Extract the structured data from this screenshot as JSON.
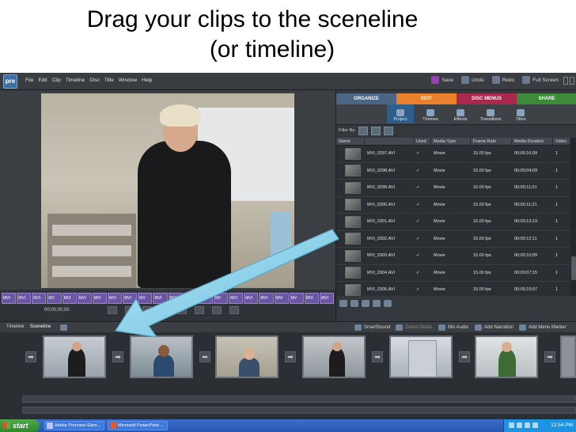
{
  "slide": {
    "title_line1": "Drag your clips to the sceneline",
    "title_line2": "(or timeline)"
  },
  "app": {
    "logo_text": "pre",
    "menu": [
      "File",
      "Edit",
      "Clip",
      "Timeline",
      "Disc",
      "Title",
      "Window",
      "Help"
    ],
    "top_buttons": {
      "save": "Save",
      "undo": "Undo",
      "redo": "Redo",
      "full_screen": "Full Screen"
    }
  },
  "monitor": {
    "timecode": "00;00;00;00",
    "filmstrip": [
      "MVI",
      "MVI",
      "MVI",
      "MV",
      "MVI",
      "MVI",
      "MVI",
      "MVI",
      "MVI",
      "MV",
      "MVI",
      "MVI",
      "MVI",
      "MVI",
      "MV",
      "MVI",
      "MVI",
      "MVI",
      "MVI",
      "MV",
      "MVI",
      "MVI"
    ]
  },
  "panel": {
    "main_tabs": [
      "ORGANIZE",
      "EDIT",
      "DISC MENUS",
      "SHARE"
    ],
    "active_main_tab": "EDIT",
    "sub_tabs": [
      "Project",
      "Themes",
      "Effects",
      "Transitions",
      "Titles"
    ],
    "active_sub_tab": "Project",
    "filter_label": "Filter By:",
    "columns": [
      "Name",
      "",
      "Used",
      "Media Type",
      "Frame Rate",
      "Media Duration",
      "Video"
    ],
    "rows": [
      {
        "name": "MVI_0297.AVI",
        "type": "Movie",
        "rate": "15.00 fps",
        "duration": "00;00;16;09",
        "video": "1"
      },
      {
        "name": "MVI_0298.AVI",
        "type": "Movie",
        "rate": "15.00 fps",
        "duration": "00;00;04;09",
        "video": "1"
      },
      {
        "name": "MVI_0299.AVI",
        "type": "Movie",
        "rate": "15.00 fps",
        "duration": "00;00;11;01",
        "video": "1"
      },
      {
        "name": "MVI_0300.AVI",
        "type": "Movie",
        "rate": "15.00 fps",
        "duration": "00;00;11;21",
        "video": "1"
      },
      {
        "name": "MVI_0301.AVI",
        "type": "Movie",
        "rate": "15.00 fps",
        "duration": "00;00;13;19",
        "video": "1"
      },
      {
        "name": "MVI_0302.AVI",
        "type": "Movie",
        "rate": "15.00 fps",
        "duration": "00;00;12;11",
        "video": "1"
      },
      {
        "name": "MVI_0303.AVI",
        "type": "Movie",
        "rate": "15.00 fps",
        "duration": "00;00;10;09",
        "video": "1"
      },
      {
        "name": "MVI_0304.AVI",
        "type": "Movie",
        "rate": "15.00 fps",
        "duration": "00;00;07;15",
        "video": "1"
      },
      {
        "name": "MVI_0305.AVI",
        "type": "Movie",
        "rate": "15.00 fps",
        "duration": "00;00;10;07",
        "video": "1"
      }
    ],
    "check_glyph": "✓"
  },
  "sceneline": {
    "tab_timeline": "Timeline",
    "tab_sceneline": "Sceneline",
    "tools": [
      "SmartSound",
      "Detect Beats",
      "Mix Audio",
      "Add Narration",
      "Add Menu Marker"
    ],
    "arrow_glyph": "➡"
  },
  "taskbar": {
    "start": "start",
    "items": [
      "Adobe Premiere Elem...",
      "Microsoft PowerPoint ..."
    ],
    "clock": "12:54 PM"
  },
  "colors": {
    "organize_tab": "#4c6585",
    "edit_tab": "#e9802b",
    "disc_tab": "#a8294d",
    "share_tab": "#3c8a3a",
    "annotation_arrow": "#8fd3ea"
  }
}
